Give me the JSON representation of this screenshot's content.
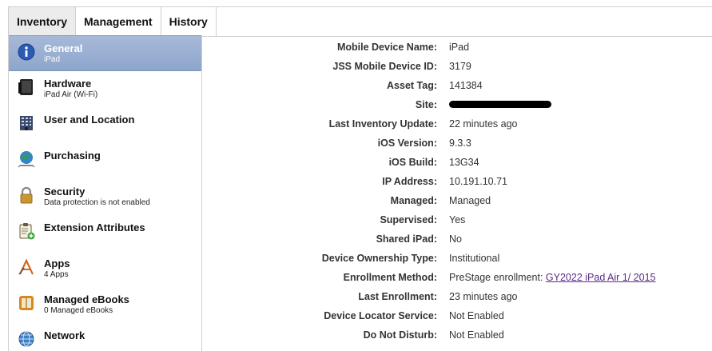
{
  "tabs": [
    {
      "label": "Inventory",
      "active": true
    },
    {
      "label": "Management",
      "active": false
    },
    {
      "label": "History",
      "active": false
    }
  ],
  "sidebar": {
    "items": [
      {
        "title": "General",
        "subtitle": "iPad",
        "icon": "info-icon",
        "selected": true
      },
      {
        "title": "Hardware",
        "subtitle": "iPad Air (Wi-Fi)",
        "icon": "ipad-hardware-icon"
      },
      {
        "title": "User and Location",
        "subtitle": "",
        "icon": "building-icon"
      },
      {
        "title": "Purchasing",
        "subtitle": "",
        "icon": "globe-icon"
      },
      {
        "title": "Security",
        "subtitle": "Data protection is not enabled",
        "icon": "padlock-icon"
      },
      {
        "title": "Extension Attributes",
        "subtitle": "",
        "icon": "clipboard-add-icon"
      },
      {
        "title": "Apps",
        "subtitle": "4 Apps",
        "icon": "app-store-icon"
      },
      {
        "title": "Managed eBooks",
        "subtitle": "0 Managed eBooks",
        "icon": "ibooks-icon"
      },
      {
        "title": "Network",
        "subtitle": "",
        "icon": "network-globe-icon"
      }
    ]
  },
  "details": {
    "rows": [
      {
        "label": "Mobile Device Name:",
        "value": "iPad"
      },
      {
        "label": "JSS Mobile Device ID:",
        "value": "3179"
      },
      {
        "label": "Asset Tag:",
        "value": "141384"
      },
      {
        "label": "Site:",
        "value": "",
        "redacted": true
      },
      {
        "label": "Last Inventory Update:",
        "value": "22 minutes ago"
      },
      {
        "label": "iOS Version:",
        "value": "9.3.3"
      },
      {
        "label": "iOS Build:",
        "value": "13G34"
      },
      {
        "label": "IP Address:",
        "value": "10.191.10.71"
      },
      {
        "label": "Managed:",
        "value": "Managed"
      },
      {
        "label": "Supervised:",
        "value": "Yes"
      },
      {
        "label": "Shared iPad:",
        "value": "No"
      },
      {
        "label": "Device Ownership Type:",
        "value": "Institutional"
      },
      {
        "label": "Enrollment Method:",
        "value": "PreStage enrollment: ",
        "link": "GY2022 iPad Air 1/ 2015"
      },
      {
        "label": "Last Enrollment:",
        "value": "23 minutes ago"
      },
      {
        "label": "Device Locator Service:",
        "value": "Not Enabled"
      },
      {
        "label": "Do Not Disturb:",
        "value": "Not Enabled"
      }
    ]
  },
  "colors": {
    "selected_row": "#9bb0d4",
    "link": "#5b2a86"
  }
}
